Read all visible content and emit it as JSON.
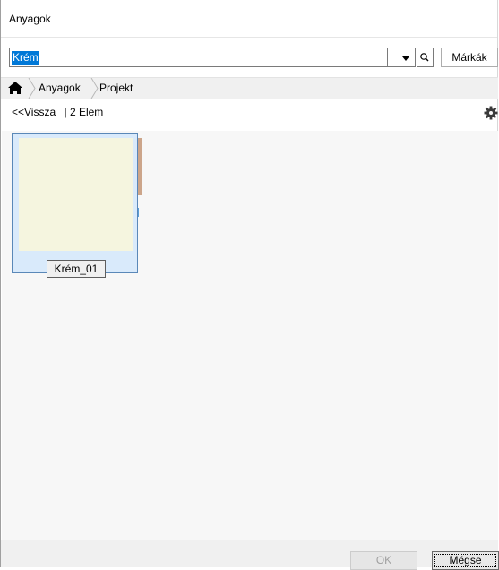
{
  "window": {
    "title": "Anyagok"
  },
  "search": {
    "value": "Krém",
    "brands_button": "Márkák"
  },
  "breadcrumb": {
    "items": [
      "Anyagok",
      "Projekt"
    ]
  },
  "nav": {
    "back_label": "<<Vissza",
    "count_label": "| 2 Elem"
  },
  "tiles": [
    {
      "label": "Krém_01",
      "swatch_color": "#f5f5df"
    }
  ],
  "footer": {
    "ok_label": "OK",
    "cancel_label": "Mégse"
  },
  "icons": {
    "home": "home-icon",
    "search": "search-icon",
    "settings": "gear-icon",
    "dropdown": "chevron-down-icon"
  }
}
